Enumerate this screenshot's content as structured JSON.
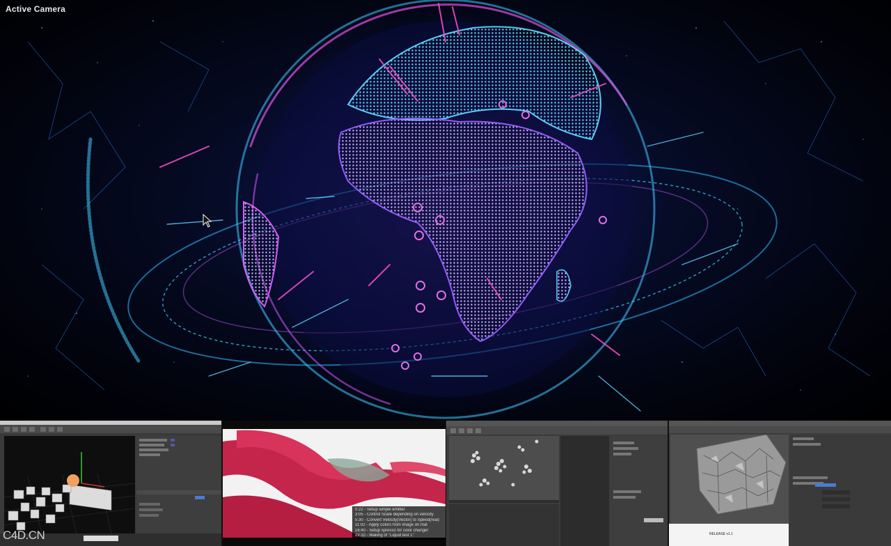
{
  "viewport": {
    "label": "Active Camera",
    "colors": {
      "cyan": "#38c8ff",
      "magenta": "#e040d8",
      "background": "#040820"
    }
  },
  "thumbnails": [
    {
      "name": "cinema4d-scene-cubes"
    },
    {
      "name": "red-fur-render",
      "chapters": [
        "0:22 - Setup simple emitter",
        "3:05 - Control Scale depending on velocity",
        "5:30 - Convert Velocity(Vector) to Speed(real)",
        "11:02 - Apply colors from image on mat",
        "16:40 - Setup xpresso for color changer",
        "22:10 - Making of \"Liquid test 1\""
      ]
    },
    {
      "name": "cinema4d-particle-clusters"
    },
    {
      "name": "cinema4d-voronoi-cube",
      "small_label": "RELEASE v1.1"
    }
  ],
  "watermark": "C4D.CN"
}
